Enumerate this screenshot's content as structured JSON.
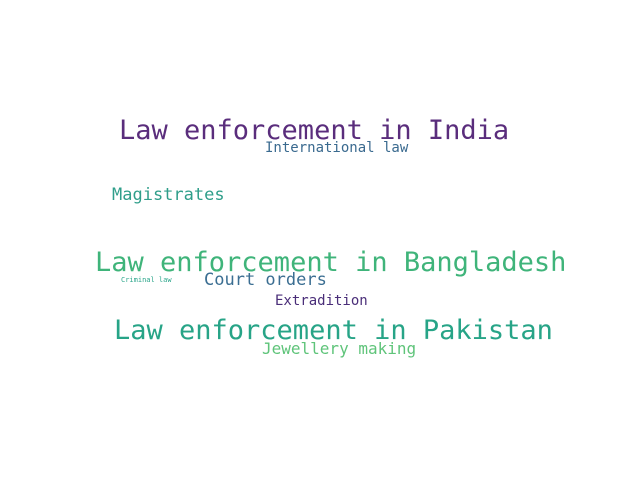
{
  "words": [
    {
      "text": "Law enforcement in India",
      "color": "#5a2d7c"
    },
    {
      "text": "International law",
      "color": "#3a6a8f"
    },
    {
      "text": "Magistrates",
      "color": "#2f9e8a"
    },
    {
      "text": "Law enforcement in Bangladesh",
      "color": "#3fb47a"
    },
    {
      "text": "Criminal law",
      "color": "#2aa58a"
    },
    {
      "text": "Court orders",
      "color": "#3b6e92"
    },
    {
      "text": "Extradition",
      "color": "#4a2e79"
    },
    {
      "text": "Law enforcement in Pakistan",
      "color": "#27a487"
    },
    {
      "text": "Jewellery making",
      "color": "#5fc47a"
    }
  ]
}
